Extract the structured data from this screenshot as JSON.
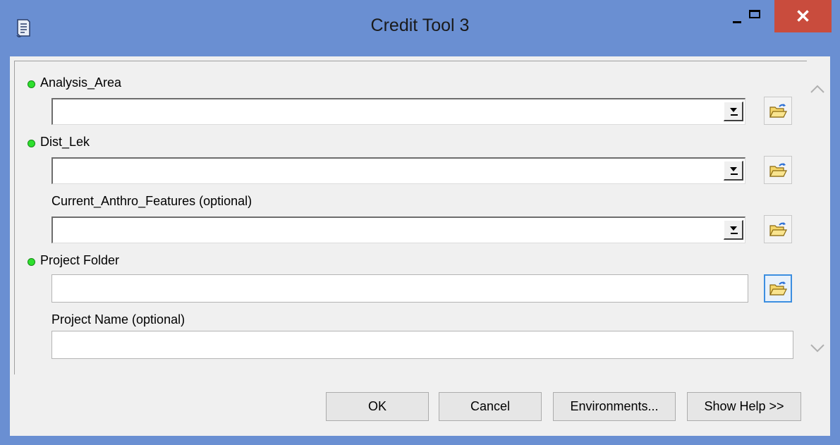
{
  "window": {
    "title": "Credit Tool 3",
    "close_glyph": "✕",
    "app_icon": "script-tool-icon",
    "accent_color": "#6a8fd2",
    "close_color": "#c94c3d"
  },
  "params": [
    {
      "label": "Analysis_Area",
      "required": true,
      "type": "combo",
      "value": ""
    },
    {
      "label": "Dist_Lek",
      "required": true,
      "type": "combo",
      "value": ""
    },
    {
      "label": "Current_Anthro_Features (optional)",
      "required": false,
      "type": "combo",
      "value": ""
    },
    {
      "label": "Project Folder",
      "required": true,
      "type": "text",
      "value": ""
    },
    {
      "label": "Project Name (optional)",
      "required": false,
      "type": "text",
      "value": ""
    }
  ],
  "buttons": {
    "ok": "OK",
    "cancel": "Cancel",
    "environments": "Environments...",
    "show_help": "Show Help >>"
  }
}
